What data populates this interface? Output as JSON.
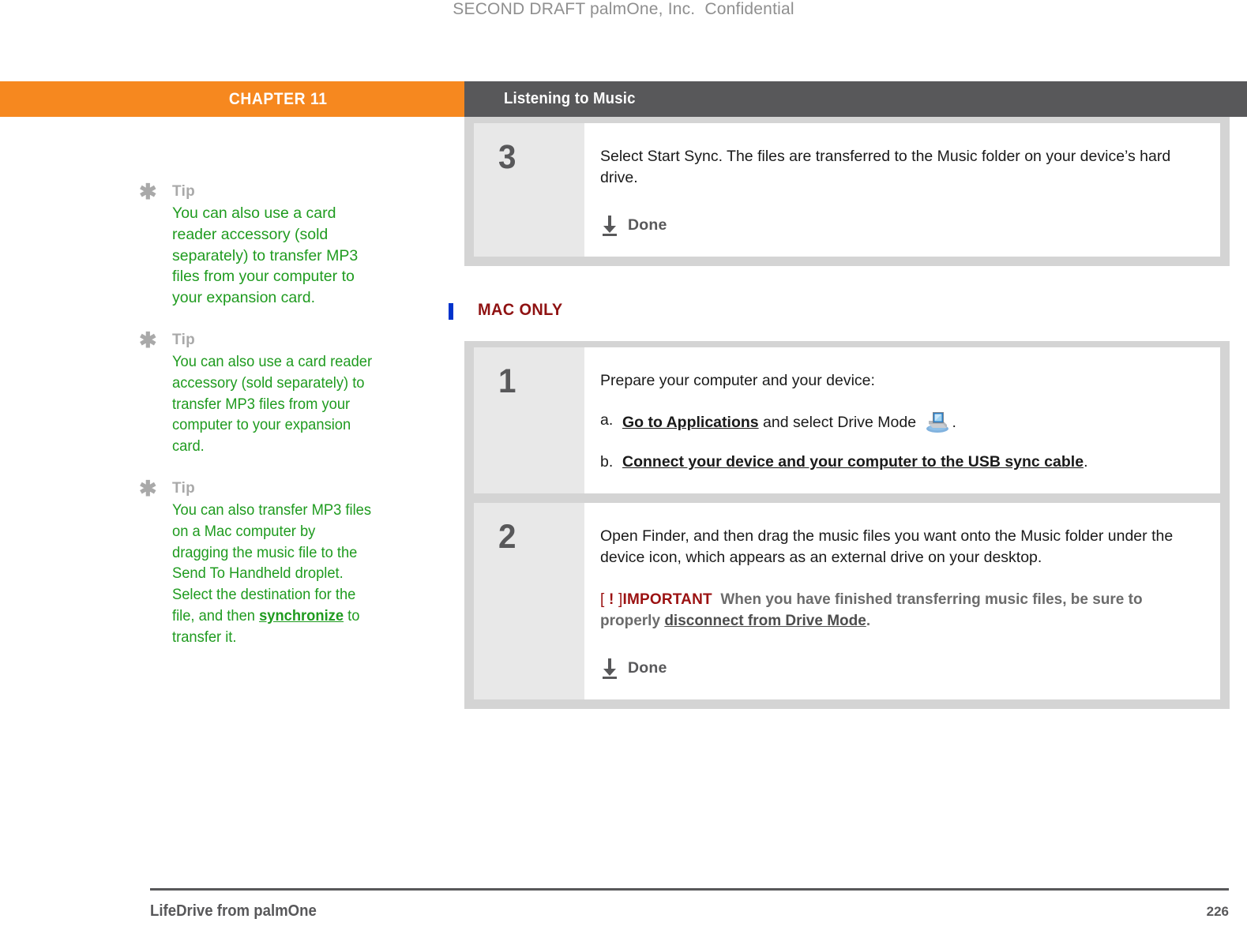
{
  "draft_stamp": "SECOND DRAFT palmOne, Inc.  Confidential",
  "header": {
    "chapter_label": "CHAPTER 11",
    "section_label": "Listening to Music"
  },
  "tips": [
    {
      "icon": "asterisk-icon",
      "title": "Tip",
      "text": "You can also use a card reader accessory (sold separately) to transfer MP3 files from your computer to your expansion card."
    },
    {
      "icon": "asterisk-icon",
      "title": "Tip",
      "text": "You can also use a card reader accessory (sold separately) to transfer MP3 files from your computer to your expansion card."
    },
    {
      "icon": "asterisk-icon",
      "title": "Tip",
      "text_before_link": "You can also transfer MP3 files on a Mac computer by dragging the music file to the Send To Handheld droplet. Select the destination for the file, and then ",
      "link_text": "synchronize",
      "text_after_link": " to transfer it."
    }
  ],
  "main": {
    "windows_group": {
      "steps": [
        {
          "number": "3",
          "body": "Select Start Sync. The files are transferred to the Music folder on your device’s hard drive.",
          "done_label": "Done",
          "done_icon": "download-arrow-icon"
        }
      ]
    },
    "section_head": {
      "label": "MAC ONLY",
      "change_bar_color": "#0033cc",
      "text_color": "#8f1212"
    },
    "mac_group": {
      "steps": [
        {
          "number": "1",
          "body": "Prepare your computer and your device:",
          "substeps": [
            {
              "marker": "a.",
              "link_text": "Go to Applications",
              "text_after_link": " and select Drive Mode ",
              "icon": "drive-mode-cradle-icon",
              "text_end": "."
            },
            {
              "marker": "b.",
              "link_text": "Connect your device and your computer to the USB sync cable",
              "text_after_link": "."
            }
          ]
        },
        {
          "number": "2",
          "body": "Open Finder, and then drag the music files you want onto the Music folder under the device icon, which appears as an external drive on your desktop.",
          "important": {
            "bracket_open": "[",
            "bang": "!",
            "bracket_close": "]",
            "tag": "IMPORTANT",
            "text_before_link": "When you have finished transferring music files, be sure to properly ",
            "link_text": "disconnect from Drive Mode",
            "text_after_link": "."
          },
          "done_label": "Done",
          "done_icon": "download-arrow-icon"
        }
      ]
    }
  },
  "footer": {
    "title": "LifeDrive from palmOne",
    "page_number": "226"
  },
  "colors": {
    "chapter_orange": "#f6881f",
    "header_gray": "#58585a",
    "tip_green": "#1f9b1f",
    "tip_label_gray": "#a9a9a9",
    "important_red": "#9b1111",
    "step_frame_gray": "#d4d4d4",
    "step_number_bg": "#e8e8e8"
  }
}
